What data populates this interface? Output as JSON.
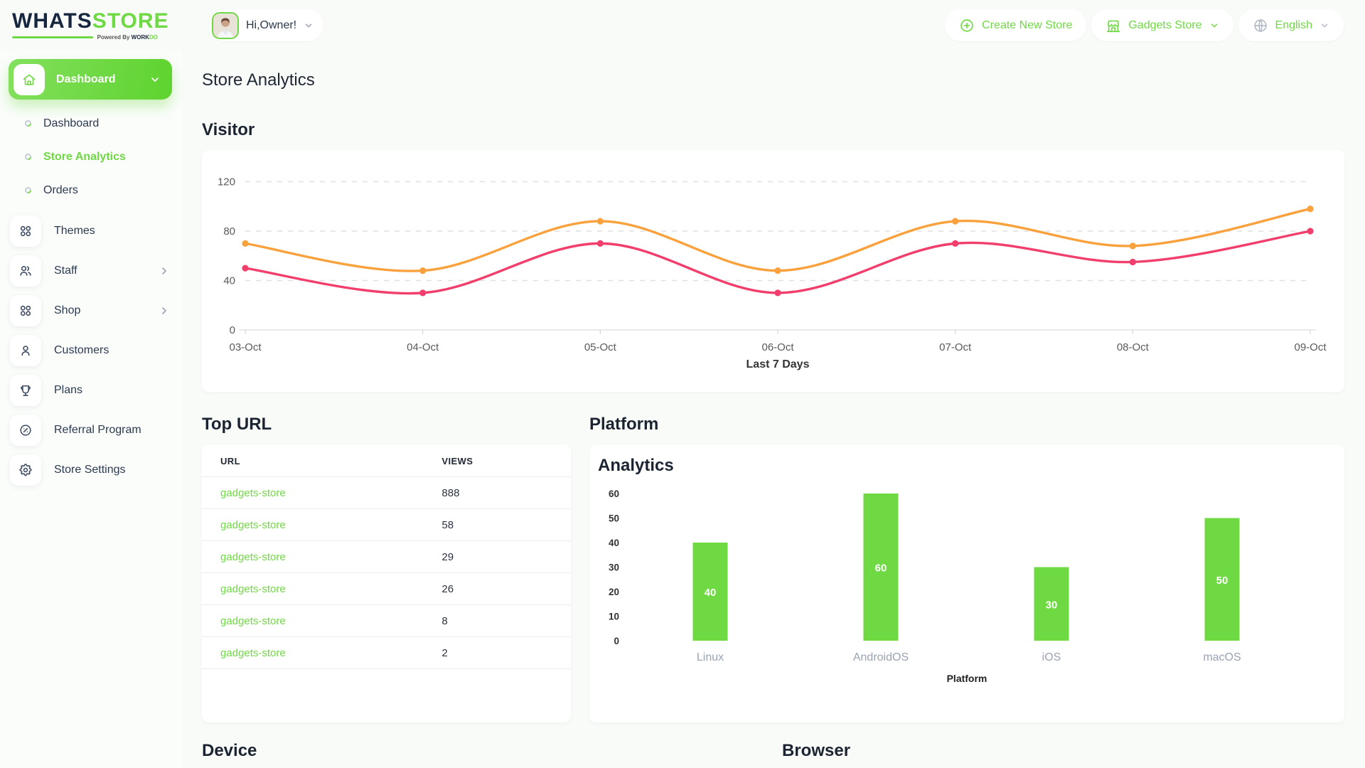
{
  "brand": {
    "name_primary": "WHATS",
    "name_secondary": "STORE",
    "powered_prefix": "Powered By",
    "powered_brand": "WORK",
    "powered_brand_suffix": "DO"
  },
  "header": {
    "greeting": "Hi,Owner!",
    "create_store_label": "Create New Store",
    "store_selector_label": "Gadgets Store",
    "language_label": "English"
  },
  "sidebar": {
    "parent": {
      "label": "Dashboard"
    },
    "sub_items": [
      {
        "label": "Dashboard"
      },
      {
        "label": "Store Analytics"
      },
      {
        "label": "Orders"
      }
    ],
    "items": [
      {
        "label": "Themes"
      },
      {
        "label": "Staff"
      },
      {
        "label": "Shop"
      },
      {
        "label": "Customers"
      },
      {
        "label": "Plans"
      },
      {
        "label": "Referral Program"
      },
      {
        "label": "Store Settings"
      }
    ]
  },
  "page": {
    "title": "Store Analytics"
  },
  "sections": {
    "visitor": "Visitor",
    "top_url": "Top URL",
    "platform": "Platform",
    "device": "Device",
    "browser": "Browser"
  },
  "top_url_table": {
    "columns": [
      "URL",
      "VIEWS"
    ],
    "rows": [
      {
        "url": "gadgets-store",
        "views": "888"
      },
      {
        "url": "gadgets-store",
        "views": "58"
      },
      {
        "url": "gadgets-store",
        "views": "29"
      },
      {
        "url": "gadgets-store",
        "views": "26"
      },
      {
        "url": "gadgets-store",
        "views": "8"
      },
      {
        "url": "gadgets-store",
        "views": "2"
      }
    ]
  },
  "chart_data": [
    {
      "type": "line",
      "title": "Visitor",
      "x": [
        "03-Oct",
        "04-Oct",
        "05-Oct",
        "06-Oct",
        "07-Oct",
        "08-Oct",
        "09-Oct"
      ],
      "series": [
        {
          "color": "#F9A13C",
          "values": [
            70,
            48,
            88,
            48,
            88,
            68,
            98
          ]
        },
        {
          "color": "#F23E6C",
          "values": [
            50,
            30,
            70,
            30,
            70,
            55,
            80
          ]
        }
      ],
      "yticks": [
        0,
        40,
        80,
        120
      ],
      "ylim": [
        0,
        140
      ],
      "xlabel": "Last 7 Days",
      "grid": "dashed-horizontal",
      "legend": "none"
    },
    {
      "type": "bar",
      "title": "Analytics",
      "categories": [
        "Linux",
        "AndroidOS",
        "iOS",
        "macOS"
      ],
      "values": [
        40,
        60,
        30,
        50
      ],
      "yticks": [
        0,
        10,
        20,
        30,
        40,
        50,
        60
      ],
      "ylim": [
        0,
        60
      ],
      "xlabel": "Platform",
      "bar_color": "#6FD943",
      "value_label_color": "#ffffff",
      "grid": "off",
      "legend": "none"
    }
  ],
  "colors": {
    "accent_green": "#6FD943",
    "line_orange": "#F9A13C",
    "line_pink": "#F23E6C",
    "logo_navy": "#17263F"
  }
}
